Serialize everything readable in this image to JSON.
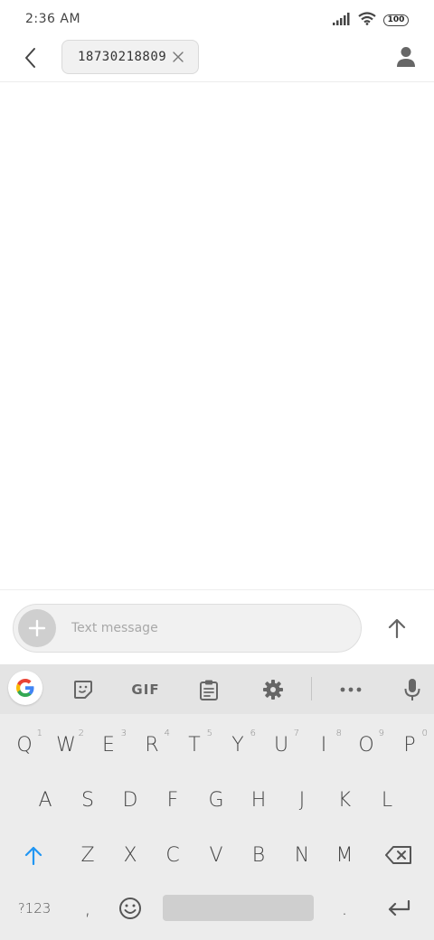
{
  "status": {
    "time": "2:36 AM",
    "battery": "100"
  },
  "header": {
    "recipient": "18730218809"
  },
  "composer": {
    "placeholder": "Text message"
  },
  "toolbar": {
    "gif_label": "GIF"
  },
  "keyboard": {
    "row1": [
      {
        "label": "Q",
        "hint": "1"
      },
      {
        "label": "W",
        "hint": "2"
      },
      {
        "label": "E",
        "hint": "3"
      },
      {
        "label": "R",
        "hint": "4"
      },
      {
        "label": "T",
        "hint": "5"
      },
      {
        "label": "Y",
        "hint": "6"
      },
      {
        "label": "U",
        "hint": "7"
      },
      {
        "label": "I",
        "hint": "8"
      },
      {
        "label": "O",
        "hint": "9"
      },
      {
        "label": "P",
        "hint": "0"
      }
    ],
    "row2": [
      "A",
      "S",
      "D",
      "F",
      "G",
      "H",
      "J",
      "K",
      "L"
    ],
    "row3": [
      "Z",
      "X",
      "C",
      "V",
      "B",
      "N",
      "M"
    ],
    "symbols_label": "?123",
    "comma": ",",
    "period": "."
  },
  "colors": {
    "accent": "#2196F3",
    "toolbar_bg": "#e4e4e4",
    "keyboard_bg": "#ececec"
  }
}
